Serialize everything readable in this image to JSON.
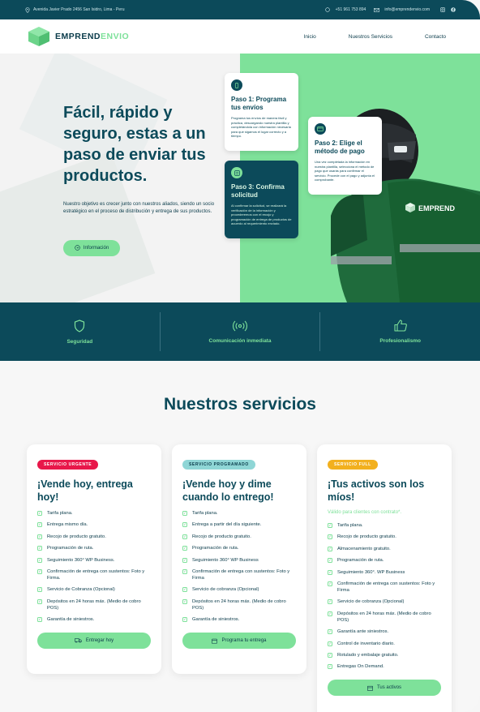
{
  "topbar": {
    "address": "Avenida Javier Prado 2456 San Isidro, Lima - Peru",
    "phone": "+51 961 753 894",
    "email": "info@emprendenvio.com"
  },
  "nav": {
    "logo_main": "EMPREND",
    "logo_accent": "ENVIO",
    "items": [
      "Inicio",
      "Nuestros Servicios",
      "Contacto"
    ]
  },
  "hero": {
    "title": "Fácil, rápido y seguro, estas a un paso de enviar tus productos.",
    "description": "Nuestro objetivo es crecer junto con nuestros aliados, siendo un socio estratégico en el proceso de distribución y entrega de sus productos.",
    "button": "Información",
    "steps": [
      {
        "title": "Paso 1: Programa tus envíos",
        "text": "Programa tus envíos de manera fácil y práctica, descargando nuestra plantilla y completándola con información necesaria para que sigamos el lugar correcto y a tiempo."
      },
      {
        "title": "Paso 2: Elige el método de pago",
        "text": "Una vez completada la información en nuestra plantilla, selecciona el método de pago que usarás para confirmar el servicio. Procede con el pago y adjunta el comprobante."
      },
      {
        "title": "Paso 3: Confirma solicitud",
        "text": "Al confirmar la solicitud, se realizará la verificación de la información y procederemos con el recojo y programación de entrega de productos de acuerdo al requerimiento enviado."
      }
    ],
    "jacket_brand": "EMPREND"
  },
  "features": [
    {
      "label": "Seguridad",
      "icon": "shield-icon"
    },
    {
      "label": "Comunicación inmediata",
      "icon": "broadcast-icon"
    },
    {
      "label": "Profesionalismo",
      "icon": "thumbs-up-icon"
    }
  ],
  "services": {
    "title": "Nuestros servicios",
    "cards": [
      {
        "badge": "SERVICIO URGENTE",
        "badge_color": "#e8174a",
        "title": "¡Vende hoy, entrega hoy!",
        "note": "",
        "items": [
          "Tarifa plana.",
          "Entrega mismo día.",
          "Recojo de producto gratuito.",
          "Programación de ruta.",
          "Seguimiento 360° WP Business.",
          "Confirmación de entrega con sustentos: Foto y Firma.",
          "Servicio de Cobranza (Opcional)",
          "Depósitos en 24 horas máx. (Medio de cobro POS)",
          "Garantía de siniestros."
        ],
        "button": "Entregar hoy"
      },
      {
        "badge": "SERVICIO PROGRAMADO",
        "badge_color": "#8fd6d6",
        "title": "¡Vende hoy y dime cuando lo entrego!",
        "note": "",
        "items": [
          "Tarifa plana.",
          "Entrega a partir del día siguiente.",
          "Recojo de producto gratuito.",
          "Programación de ruta.",
          "Seguimiento 360° WP Business",
          "Confirmación de entrega con sustentos: Foto y Firma",
          "Servicio de cobranza (Opcional)",
          "Depósitos en 24 horas máx. (Medio de cobro POS)",
          "Garantía de siniestros."
        ],
        "button": "Programa tu entrega"
      },
      {
        "badge": "SERVICIO FULL",
        "badge_color": "#f2b01e",
        "title": "¡Tus activos son los míos!",
        "note": "Válido para clientes con contrato*.",
        "items": [
          "Tarifa plana.",
          "Recojo de producto gratuito.",
          "Almacenamiento gratuito.",
          "Programación de ruta.",
          "Seguimiento 360°. WP Business",
          "Confirmación de entrega con sustentos: Foto y Firma",
          "Servicio de cobranza (Opcional)",
          "Depósitos en 24 horas máx. (Medio de cobro POS)",
          "Garantía ante siniestros.",
          "Control de inventario diario.",
          "Rotulado y embalaje gratuito.",
          "Entregas On Demand."
        ],
        "button": "Tus activos"
      }
    ]
  }
}
